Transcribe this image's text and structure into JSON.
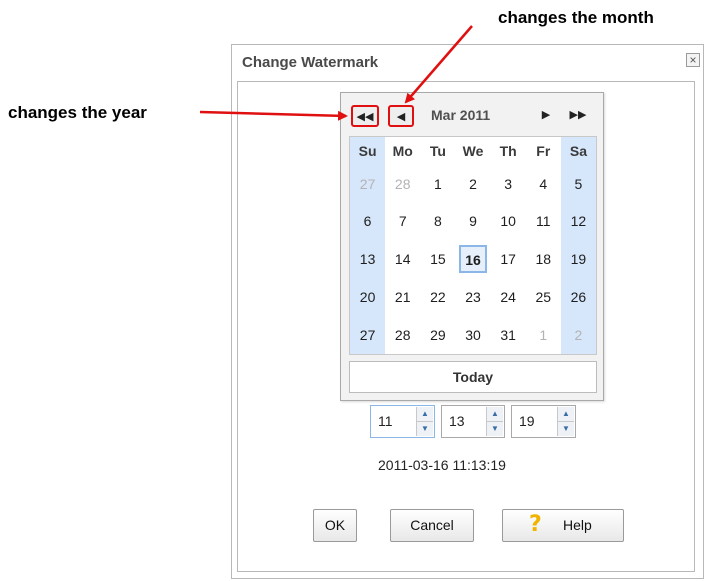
{
  "annotations": {
    "year_note": "changes the year",
    "month_note": "changes the month"
  },
  "dialog": {
    "title": "Change Watermark",
    "close_icon": "×"
  },
  "calendar": {
    "nav": {
      "prev_year_icon": "◀◀",
      "prev_month_icon": "◀",
      "next_month_icon": "▶",
      "next_year_icon": "▶▶"
    },
    "month_label": "Mar 2011",
    "weekdays": [
      "Su",
      "Mo",
      "Tu",
      "We",
      "Th",
      "Fr",
      "Sa"
    ],
    "weeks": [
      [
        "27",
        "28",
        "1",
        "2",
        "3",
        "4",
        "5"
      ],
      [
        "6",
        "7",
        "8",
        "9",
        "10",
        "11",
        "12"
      ],
      [
        "13",
        "14",
        "15",
        "16",
        "17",
        "18",
        "19"
      ],
      [
        "20",
        "21",
        "22",
        "23",
        "24",
        "25",
        "26"
      ],
      [
        "27",
        "28",
        "29",
        "30",
        "31",
        "1",
        "2"
      ]
    ],
    "selected_day": "16",
    "today_label": "Today"
  },
  "time": {
    "hour": "11",
    "minute": "13",
    "second": "19",
    "up_icon": "▲",
    "down_icon": "▼"
  },
  "datetime_display": "2011-03-16 11:13:19",
  "buttons": {
    "ok_label": "OK",
    "cancel_label": "Cancel",
    "help_label": "Help",
    "help_icon": "?"
  },
  "colors": {
    "annotation_highlight": "#e01010",
    "weekend_column": "#d7e7fb",
    "selected_border": "#8ab6e8",
    "help_icon": "#f0b400"
  }
}
